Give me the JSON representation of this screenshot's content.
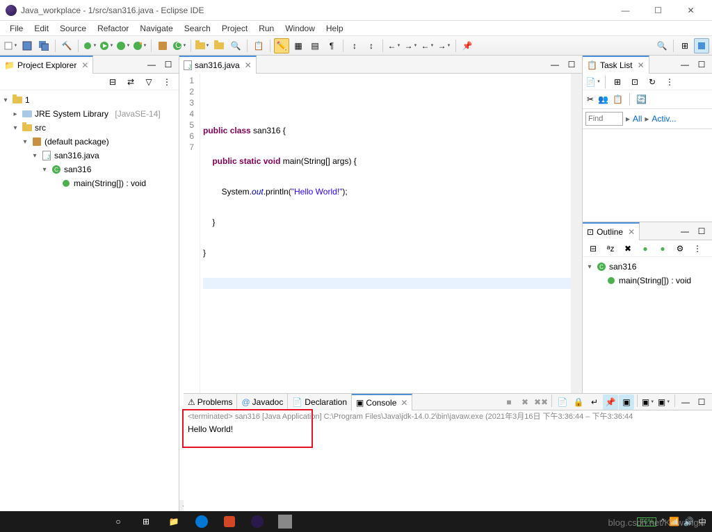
{
  "window": {
    "title": "Java_workplace - 1/src/san316.java - Eclipse IDE"
  },
  "menu": [
    "File",
    "Edit",
    "Source",
    "Refactor",
    "Navigate",
    "Search",
    "Project",
    "Run",
    "Window",
    "Help"
  ],
  "explorer": {
    "title": "Project Explorer",
    "tree": {
      "project": "1",
      "jre": "JRE System Library",
      "jre_ver": "[JavaSE-14]",
      "src": "src",
      "pkg": "(default package)",
      "file": "san316.java",
      "cls": "san316",
      "method": "main(String[]) : void"
    }
  },
  "editor": {
    "tab": "san316.java",
    "lines": [
      "1",
      "2",
      "3",
      "4",
      "5",
      "6",
      "7"
    ],
    "code": {
      "l2a": "public",
      "l2b": "class",
      "l2c": " san316 {",
      "l3a": "public",
      "l3b": "static",
      "l3c": "void",
      "l3d": " main(String[] args) {",
      "l4a": "        System.",
      "l4b": "out",
      "l4c": ".println(",
      "l4d": "\"Hello World!\"",
      "l4e": ");",
      "l5": "    }",
      "l6": "}"
    }
  },
  "tasklist": {
    "title": "Task List",
    "find_placeholder": "Find",
    "all": "All",
    "activate": "Activ..."
  },
  "outline": {
    "title": "Outline",
    "cls": "san316",
    "method": "main(String[]) : void"
  },
  "bottom": {
    "tabs": {
      "problems": "Problems",
      "javadoc": "Javadoc",
      "declaration": "Declaration",
      "console": "Console"
    },
    "console_info": "<terminated> san316 [Java Application] C:\\Program Files\\Java\\jdk-14.0.2\\bin\\javaw.exe  (2021年3月16日 下午3:36:44 – 下午3:36:44",
    "console_out": "Hello World!"
  },
  "taskbar": {
    "battery": "76%",
    "watermark": "blog.csdn.net/KDwangxi"
  }
}
